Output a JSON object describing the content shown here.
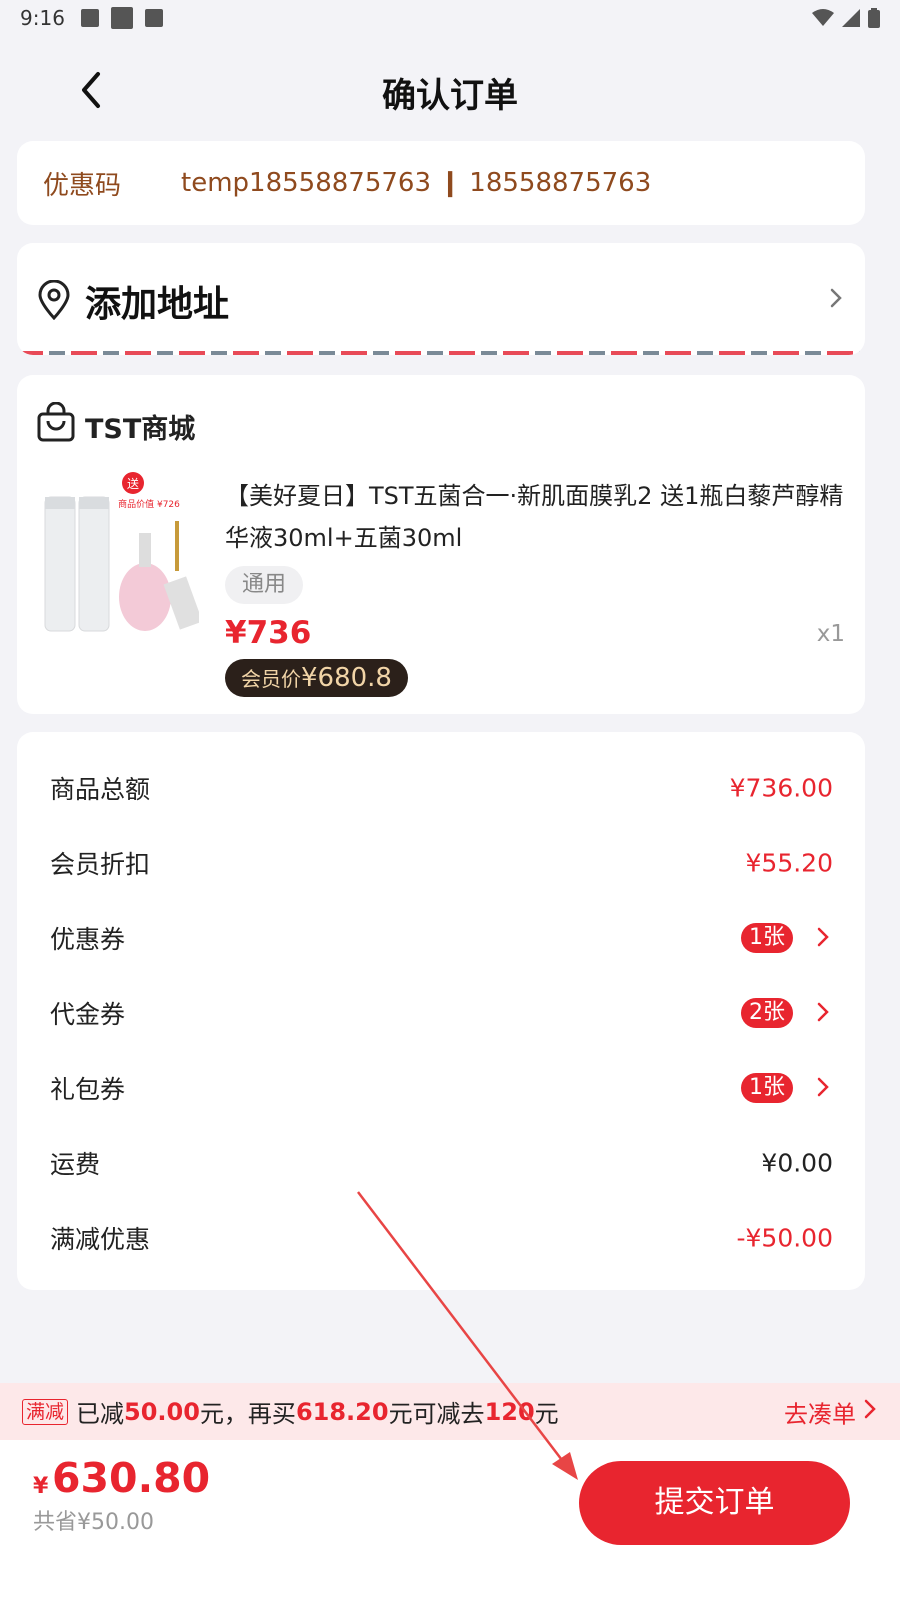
{
  "status_bar": {
    "time": "9:16"
  },
  "nav": {
    "title": "确认订单"
  },
  "coupon": {
    "label": "优惠码",
    "value": "temp18558875763 ❙ 18558875763"
  },
  "address": {
    "add_label": "添加地址"
  },
  "store": {
    "name": "TST商城",
    "product": {
      "title": "【美好夏日】TST五菌合一·新肌面膜乳2 送1瓶白藜芦醇精华液30ml+五菌30ml",
      "tag": "通用",
      "price": "¥736",
      "quantity": "x1",
      "member_label": "会员价",
      "member_price": "¥680.8",
      "image_text": {
        "gift": "送",
        "value_label": "商品价值 ¥726"
      }
    }
  },
  "summary": {
    "rows": [
      {
        "label": "商品总额",
        "value": "¥736.00"
      },
      {
        "label": "会员折扣",
        "value": "¥55.20"
      },
      {
        "label": "优惠券",
        "badge": "1张"
      },
      {
        "label": "代金券",
        "badge": "2张"
      },
      {
        "label": "礼包券",
        "badge": "1张"
      },
      {
        "label": "运费",
        "value": "¥0.00"
      },
      {
        "label": "满减优惠",
        "value": "-¥50.00"
      }
    ]
  },
  "promo": {
    "tag": "满减",
    "p1": "已减",
    "amount1": "50.00",
    "p2": "元，再买",
    "amount2": "618.20",
    "p3": "元可减去",
    "amount3": "120",
    "p4": "元",
    "link": "去凑单"
  },
  "footer": {
    "currency": "¥",
    "total": "630.80",
    "saved": "共省¥50.00",
    "submit": "提交订单"
  },
  "colors": {
    "accent": "#e8252f",
    "coupon_text": "#8f4a1e",
    "member_badge_bg": "#2b201a"
  }
}
